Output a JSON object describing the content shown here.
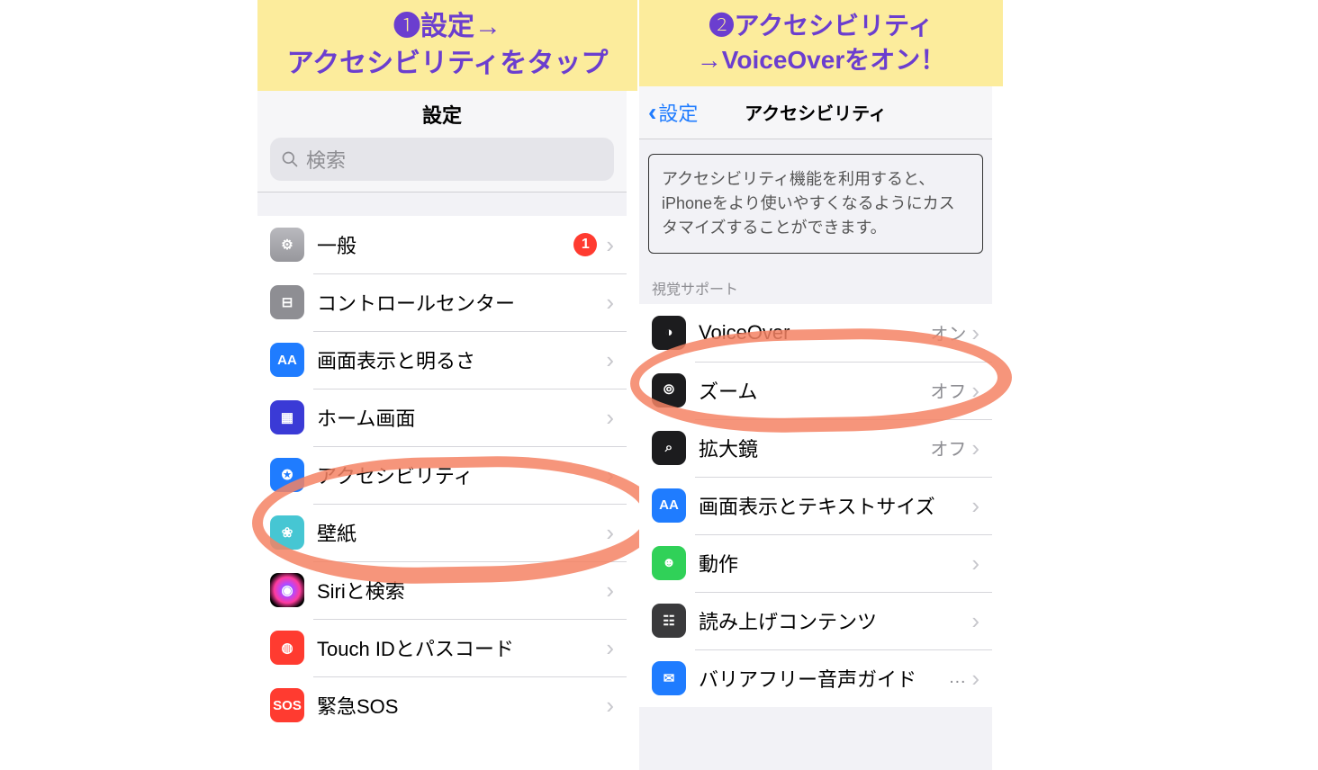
{
  "banners": {
    "left_line1": "❶設定→",
    "left_line2": "アクセシビリティをタップ",
    "right_line1": "❷アクセシビリティ",
    "right_line2": "→VoiceOverをオン！"
  },
  "left": {
    "title": "設定",
    "search_placeholder": "検索",
    "rows": [
      {
        "icon": "general",
        "label": "一般",
        "badge": "1"
      },
      {
        "icon": "control",
        "label": "コントロールセンター"
      },
      {
        "icon": "display",
        "label": "画面表示と明るさ"
      },
      {
        "icon": "home",
        "label": "ホーム画面"
      },
      {
        "icon": "access",
        "label": "アクセシビリティ"
      },
      {
        "icon": "wall",
        "label": "壁紙"
      },
      {
        "icon": "siri",
        "label": "Siriと検索"
      },
      {
        "icon": "touch",
        "label": "Touch IDとパスコード"
      },
      {
        "icon": "sos",
        "label": "緊急SOS"
      }
    ]
  },
  "right": {
    "back": "設定",
    "title": "アクセシビリティ",
    "note": "アクセシビリティ機能を利用すると、iPhoneをより使いやすくなるようにカスタマイズすることができます。",
    "section": "視覚サポート",
    "rows": [
      {
        "icon": "vo",
        "label": "VoiceOver",
        "value": "オン"
      },
      {
        "icon": "zoom",
        "label": "ズーム",
        "value": "オフ"
      },
      {
        "icon": "magn",
        "label": "拡大鏡",
        "value": "オフ"
      },
      {
        "icon": "text",
        "label": "画面表示とテキストサイズ"
      },
      {
        "icon": "motion",
        "label": "動作"
      },
      {
        "icon": "speech",
        "label": "読み上げコンテンツ"
      },
      {
        "icon": "audio",
        "label": "バリアフリー音声ガイド",
        "value": "…"
      }
    ]
  },
  "glyph": {
    "general": "⚙︎",
    "control": "⊟",
    "display": "AA",
    "home": "▦",
    "access": "✪",
    "wall": "❀",
    "siri": "◉",
    "touch": "◍",
    "sos": "SOS",
    "vo": "◑",
    "zoom": "⦾",
    "magn": "⌕",
    "text": "AA",
    "motion": "☻",
    "speech": "☷",
    "audio": "✉︎"
  }
}
